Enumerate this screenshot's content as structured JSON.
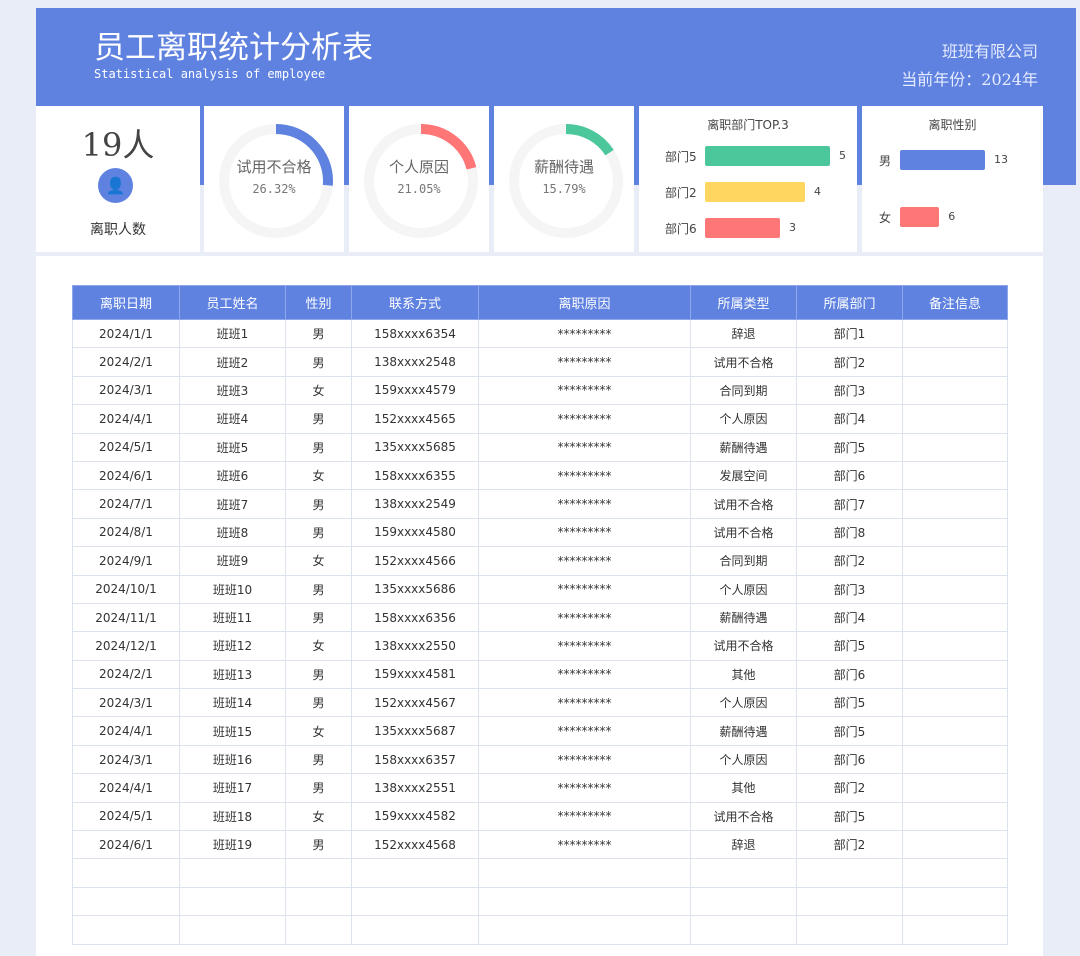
{
  "header": {
    "title": "员工离职统计分析表",
    "subtitle": "Statistical analysis of employee",
    "company": "班班有限公司",
    "year": "当前年份：2024年"
  },
  "summary": {
    "count": "19人",
    "label": "离职人数",
    "icon": "user-icon"
  },
  "donuts": [
    {
      "label": "试用不合格",
      "value": "26.32%",
      "percent": 26.32,
      "color": "#5f82e0"
    },
    {
      "label": "个人原因",
      "value": "21.05%",
      "percent": 21.05,
      "color": "#ff7676"
    },
    {
      "label": "薪酬待遇",
      "value": "15.79%",
      "percent": 15.79,
      "color": "#4cc79c"
    }
  ],
  "dept_top": {
    "title": "离职部门TOP.3",
    "items": [
      {
        "label": "部门5",
        "value": "5",
        "n": 5,
        "color": "#4cc79c"
      },
      {
        "label": "部门2",
        "value": "4",
        "n": 4,
        "color": "#ffd760"
      },
      {
        "label": "部门6",
        "value": "3",
        "n": 3,
        "color": "#ff7676"
      }
    ]
  },
  "gender": {
    "title": "离职性别",
    "items": [
      {
        "label": "男",
        "value": "13",
        "n": 13,
        "color": "#5f82e0"
      },
      {
        "label": "女",
        "value": "6",
        "n": 6,
        "color": "#ff7676"
      }
    ]
  },
  "table": {
    "headers": [
      "离职日期",
      "员工姓名",
      "性别",
      "联系方式",
      "离职原因",
      "所属类型",
      "所属部门",
      "备注信息"
    ],
    "rows": [
      [
        "2024/1/1",
        "班班1",
        "男",
        "158xxxx6354",
        "*********",
        "辞退",
        "部门1",
        ""
      ],
      [
        "2024/2/1",
        "班班2",
        "男",
        "138xxxx2548",
        "*********",
        "试用不合格",
        "部门2",
        ""
      ],
      [
        "2024/3/1",
        "班班3",
        "女",
        "159xxxx4579",
        "*********",
        "合同到期",
        "部门3",
        ""
      ],
      [
        "2024/4/1",
        "班班4",
        "男",
        "152xxxx4565",
        "*********",
        "个人原因",
        "部门4",
        ""
      ],
      [
        "2024/5/1",
        "班班5",
        "男",
        "135xxxx5685",
        "*********",
        "薪酬待遇",
        "部门5",
        ""
      ],
      [
        "2024/6/1",
        "班班6",
        "女",
        "158xxxx6355",
        "*********",
        "发展空间",
        "部门6",
        ""
      ],
      [
        "2024/7/1",
        "班班7",
        "男",
        "138xxxx2549",
        "*********",
        "试用不合格",
        "部门7",
        ""
      ],
      [
        "2024/8/1",
        "班班8",
        "男",
        "159xxxx4580",
        "*********",
        "试用不合格",
        "部门8",
        ""
      ],
      [
        "2024/9/1",
        "班班9",
        "女",
        "152xxxx4566",
        "*********",
        "合同到期",
        "部门2",
        ""
      ],
      [
        "2024/10/1",
        "班班10",
        "男",
        "135xxxx5686",
        "*********",
        "个人原因",
        "部门3",
        ""
      ],
      [
        "2024/11/1",
        "班班11",
        "男",
        "158xxxx6356",
        "*********",
        "薪酬待遇",
        "部门4",
        ""
      ],
      [
        "2024/12/1",
        "班班12",
        "女",
        "138xxxx2550",
        "*********",
        "试用不合格",
        "部门5",
        ""
      ],
      [
        "2024/2/1",
        "班班13",
        "男",
        "159xxxx4581",
        "*********",
        "其他",
        "部门6",
        ""
      ],
      [
        "2024/3/1",
        "班班14",
        "男",
        "152xxxx4567",
        "*********",
        "个人原因",
        "部门5",
        ""
      ],
      [
        "2024/4/1",
        "班班15",
        "女",
        "135xxxx5687",
        "*********",
        "薪酬待遇",
        "部门5",
        ""
      ],
      [
        "2024/3/1",
        "班班16",
        "男",
        "158xxxx6357",
        "*********",
        "个人原因",
        "部门6",
        ""
      ],
      [
        "2024/4/1",
        "班班17",
        "男",
        "138xxxx2551",
        "*********",
        "其他",
        "部门2",
        ""
      ],
      [
        "2024/5/1",
        "班班18",
        "女",
        "159xxxx4582",
        "*********",
        "试用不合格",
        "部门5",
        ""
      ],
      [
        "2024/6/1",
        "班班19",
        "男",
        "152xxxx4568",
        "*********",
        "辞退",
        "部门2",
        ""
      ],
      [
        "",
        "",
        "",
        "",
        "",
        "",
        "",
        ""
      ],
      [
        "",
        "",
        "",
        "",
        "",
        "",
        "",
        ""
      ],
      [
        "",
        "",
        "",
        "",
        "",
        "",
        "",
        ""
      ]
    ]
  }
}
